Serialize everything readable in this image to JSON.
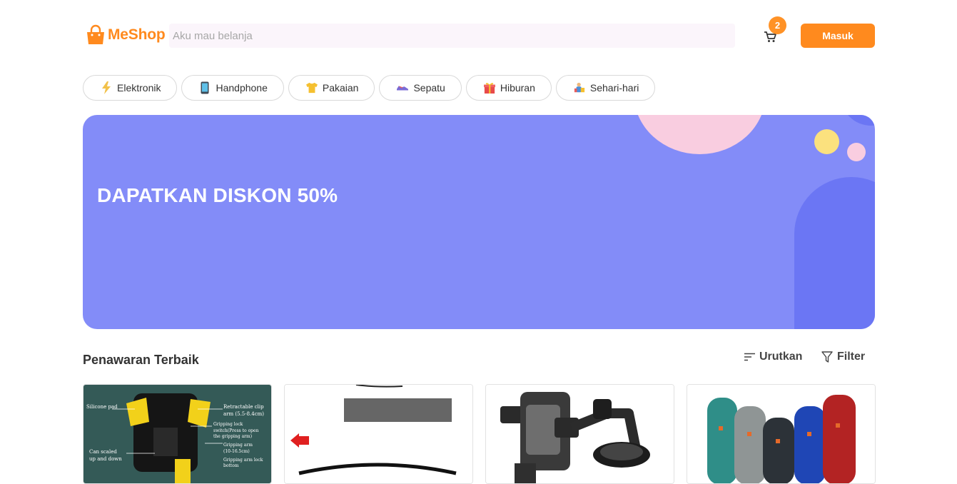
{
  "brand": {
    "name": "MeShop",
    "color": "#ff8a1e"
  },
  "search": {
    "placeholder": "Aku mau belanja"
  },
  "cart": {
    "icon": "cart-icon",
    "count": "2"
  },
  "header": {
    "login_label": "Masuk"
  },
  "categories": [
    {
      "label": "Elektronik",
      "icon": "lightning-icon"
    },
    {
      "label": "Handphone",
      "icon": "phone-icon"
    },
    {
      "label": "Pakaian",
      "icon": "shirt-icon"
    },
    {
      "label": "Sepatu",
      "icon": "shoe-icon"
    },
    {
      "label": "Hiburan",
      "icon": "gift-icon"
    },
    {
      "label": "Sehari-hari",
      "icon": "shopper-icon"
    }
  ],
  "banner": {
    "title": "DAPATKAN DISKON 50%",
    "background": "#838cf8"
  },
  "section": {
    "title": "Penawaran Terbaik",
    "sort_label": "Urutkan",
    "filter_label": "Filter"
  },
  "products": [
    {
      "name": "phone-holder-diagram",
      "annotations": [
        "Silicone pad",
        "Retractable clip",
        "arm  (5.5-8.4cm)",
        "Gripping lock",
        "switch(Press to open",
        "the gripping arm)",
        "Gripping arm",
        "(10-16.5cm)",
        "Gripping arm lock",
        "bottom",
        "Can scaled",
        "up and down"
      ]
    },
    {
      "name": "product-image-2"
    },
    {
      "name": "phone-car-mount"
    },
    {
      "name": "bluetooth-speakers"
    }
  ]
}
